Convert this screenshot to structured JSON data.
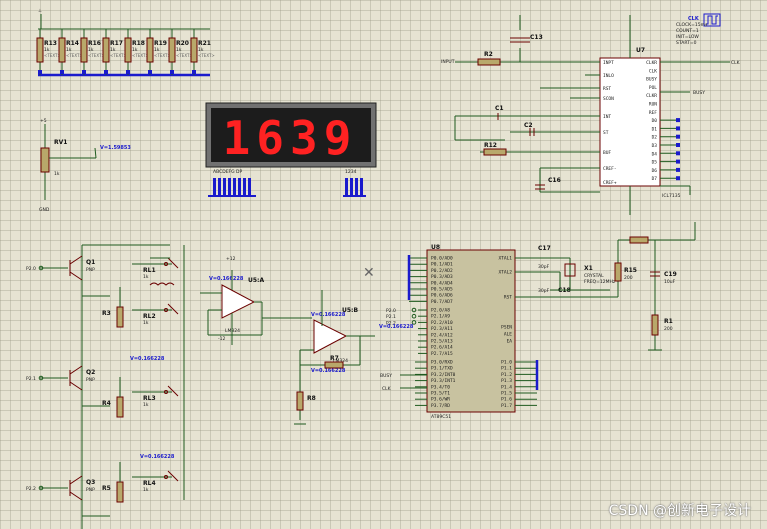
{
  "display": {
    "digits": "1639",
    "seg_labels": "ABCDEFG DP",
    "digit_labels": "1234"
  },
  "resistors_top": [
    "R13",
    "R14",
    "R16",
    "R17",
    "R18",
    "R19",
    "R20",
    "R21"
  ],
  "resistor_value": "1k",
  "rv1": {
    "name": "RV1",
    "value": "1k",
    "probe": "V=1.59853",
    "ground": "GND"
  },
  "u7": {
    "name": "U7",
    "left_pins": [
      "INPT",
      "INLO",
      "RST",
      "SCON",
      "INT",
      "ST",
      "BUF",
      "CREF-",
      "CREF+"
    ],
    "right_pins": [
      "CLKR",
      "CLK",
      "BUSY",
      "POL",
      "CLKR",
      "RUN",
      "REF",
      "D0",
      "D1",
      "D2",
      "D3",
      "D4",
      "D5",
      "D6",
      "D7"
    ],
    "clk_label": "CLK",
    "clk_props": [
      "CLOCK=15ms",
      "COUNT=1",
      "INIT=LOW",
      "START=0"
    ],
    "busy_label": "BUSY",
    "iclt": "ICL7135"
  },
  "caps_top": [
    "C13",
    "C1",
    "C2",
    "C16"
  ],
  "r2": "R2",
  "r12": "R12",
  "input_label": "INPUT",
  "u8": {
    "name": "U8",
    "port0": [
      "P0.0/AD0",
      "P0.1/AD1",
      "P0.2/AD2",
      "P0.3/AD3",
      "P0.4/AD4",
      "P0.5/AD5",
      "P0.6/AD6",
      "P0.7/AD7"
    ],
    "port2": [
      "P2.0/A8",
      "P2.1/A9",
      "P2.2/A10",
      "P2.3/A11",
      "P2.4/A12",
      "P2.5/A13",
      "P2.6/A14",
      "P2.7/A15"
    ],
    "port3": [
      "P3.0/RXD",
      "P3.1/TXD",
      "P3.2/INT0",
      "P3.3/INT1",
      "P3.4/T0",
      "P3.5/T1",
      "P3.6/WR",
      "P3.7/RD"
    ],
    "port1": [
      "P1.0",
      "P1.1",
      "P1.2",
      "P1.3",
      "P1.4",
      "P1.5",
      "P1.6",
      "P1.7"
    ],
    "left_top": [
      "XTAL1",
      "XTAL2",
      "RST"
    ],
    "right_mid": [
      "PSEN",
      "ALE",
      "EA"
    ],
    "chip": "AT89C51",
    "bus_in": [
      "P2.0",
      "P2.1",
      "P2.2"
    ],
    "busy": "BUSY",
    "clk": "CLK"
  },
  "osc": {
    "c17": "C17",
    "c18": "C18",
    "x1": "X1",
    "crystal": "CRYSTAL",
    "freq": "FREQ=12MHz",
    "cap": "30pF"
  },
  "reset": {
    "r15": "R15",
    "c19": "C19",
    "r1": "R1",
    "r_val": "200",
    "c_val": "10uF"
  },
  "transistors": [
    {
      "name": "Q1",
      "type": "PNP",
      "input": "P2.0"
    },
    {
      "name": "Q2",
      "type": "PNP",
      "input": "P2.1"
    },
    {
      "name": "Q3",
      "type": "PNP",
      "input": "P2.2"
    }
  ],
  "relays": [
    "RL1",
    "RL2",
    "RL3",
    "RL4"
  ],
  "res_left": [
    "R3",
    "R4",
    "R5"
  ],
  "u5a": {
    "name": "U5:A",
    "probe": "V=0.166228",
    "vplus": "+12",
    "vminus": "-12",
    "part": "LM324"
  },
  "u5b": {
    "name": "U5:B",
    "probe_in": "V=0.166228",
    "probe_out": "V=0.166228",
    "probe_fb": "V=0.166228",
    "part": "LM324"
  },
  "r_feedback": [
    "R7",
    "R8"
  ],
  "probes_left": [
    "V=0.166228",
    "V=0.166228"
  ],
  "text_tag": "<TEXT>",
  "watermark": "CSDN @创新电子设计"
}
